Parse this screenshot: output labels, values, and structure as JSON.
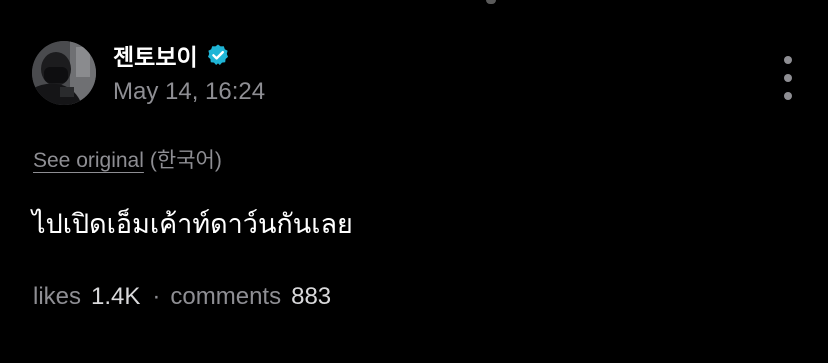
{
  "post": {
    "author": {
      "name": "젠토보이",
      "verified": true,
      "verified_color": "#1fb5d6"
    },
    "timestamp": "May 14, 16:24",
    "translation": {
      "see_original_label": "See original",
      "source_language": "(한국어)"
    },
    "text": "ไปเปิดเอ็มเค้าท์ดาว์นกันเลย",
    "stats": {
      "likes_label": "likes",
      "likes_value": "1.4K",
      "separator": "·",
      "comments_label": "comments",
      "comments_value": "883"
    }
  },
  "icons": {
    "more": "more-vertical-icon",
    "verified": "verified-badge-icon"
  },
  "colors": {
    "background": "#000000",
    "primary_text": "#ffffff",
    "secondary_text": "#8e8e93"
  }
}
